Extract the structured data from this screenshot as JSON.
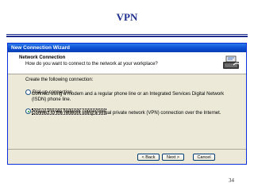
{
  "slide": {
    "title": "VPN",
    "page_number": "34"
  },
  "window": {
    "title": "New Connection Wizard"
  },
  "header": {
    "title": "Network Connection",
    "subtitle": "How do you want to connect to the network at your workplace?",
    "icon": "network-connection-icon"
  },
  "body": {
    "prompt": "Create the following connection:",
    "options": [
      {
        "label": "Dial-up connection",
        "description": "Connect using a modem and a regular phone line or an Integrated Services Digital Network (ISDN) phone line.",
        "selected": false
      },
      {
        "label": "Virtual Private Network connection",
        "description": "Connect to the network using a virtual private network (VPN) connection over the Internet.",
        "selected": true
      }
    ]
  },
  "footer": {
    "back_label": "< Back",
    "next_label": "Next >",
    "cancel_label": "Cancel"
  }
}
